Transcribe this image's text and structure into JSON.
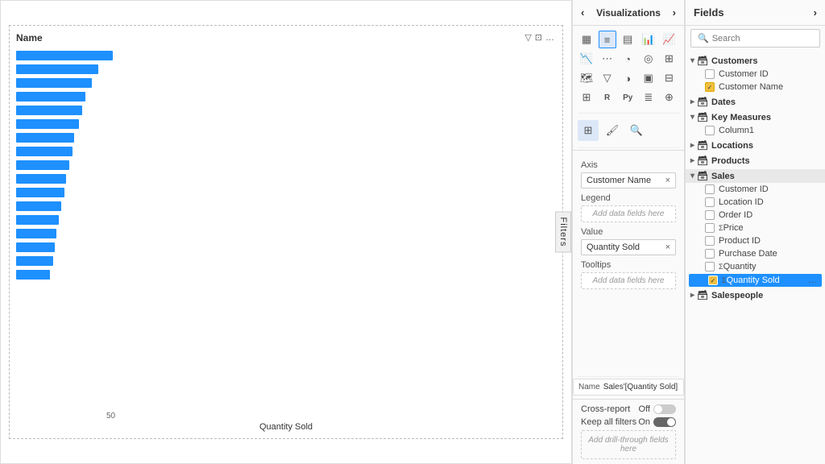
{
  "chart": {
    "title": "Name",
    "x_label": "Quantity Sold",
    "x_tick": "50",
    "bars": [
      100,
      85,
      78,
      72,
      68,
      65,
      60,
      58,
      55,
      52,
      50,
      47,
      44,
      42,
      40,
      38,
      35
    ]
  },
  "filters_tab": "Filters",
  "viz_panel": {
    "title": "Visualizations",
    "arrow_left": "‹",
    "arrow_right": "›"
  },
  "axis": {
    "label": "Axis",
    "value": "Customer Name",
    "clear": "×"
  },
  "legend": {
    "label": "Legend",
    "placeholder": "Add data fields here"
  },
  "value": {
    "label": "Value",
    "value": "Quantity Sold",
    "clear": "×"
  },
  "tooltips": {
    "label": "Tooltips",
    "placeholder": "Add data fields here"
  },
  "name_row": {
    "label": "Name",
    "value": "Sales'[Quantity Sold]"
  },
  "cross_report": {
    "label": "Cross-report",
    "state": "Off"
  },
  "keep_all_filters": {
    "label": "Keep all filters",
    "state": "On"
  },
  "drill_placeholder": "Add drill-through fields here",
  "fields_panel": {
    "title": "Fields",
    "arrow": "›",
    "search_placeholder": "Search"
  },
  "tree": {
    "groups": [
      {
        "name": "Customers",
        "icon": "🗃",
        "expanded": true,
        "items": [
          {
            "label": "Customer ID",
            "checked": false,
            "sigma": false
          },
          {
            "label": "Customer Name",
            "checked": true,
            "sigma": false
          }
        ]
      },
      {
        "name": "Dates",
        "icon": "🗃",
        "expanded": false,
        "items": []
      },
      {
        "name": "Key Measures",
        "icon": "🗃",
        "expanded": true,
        "items": [
          {
            "label": "Column1",
            "checked": false,
            "sigma": false
          }
        ]
      },
      {
        "name": "Locations",
        "icon": "🗃",
        "expanded": false,
        "items": []
      },
      {
        "name": "Products",
        "icon": "🗃",
        "expanded": false,
        "items": []
      },
      {
        "name": "Sales",
        "icon": "🗃",
        "expanded": true,
        "highlight": true,
        "items": [
          {
            "label": "Customer ID",
            "checked": false,
            "sigma": false
          },
          {
            "label": "Location ID",
            "checked": false,
            "sigma": false
          },
          {
            "label": "Order ID",
            "checked": false,
            "sigma": false
          },
          {
            "label": "Price",
            "checked": false,
            "sigma": true
          },
          {
            "label": "Product ID",
            "checked": false,
            "sigma": false
          },
          {
            "label": "Purchase Date",
            "checked": false,
            "sigma": false
          },
          {
            "label": "Quantity",
            "checked": false,
            "sigma": true
          },
          {
            "label": "Quantity Sold",
            "checked": true,
            "sigma": true,
            "highlighted": true
          }
        ]
      },
      {
        "name": "Salespeople",
        "icon": "🗃",
        "expanded": false,
        "items": []
      }
    ]
  }
}
